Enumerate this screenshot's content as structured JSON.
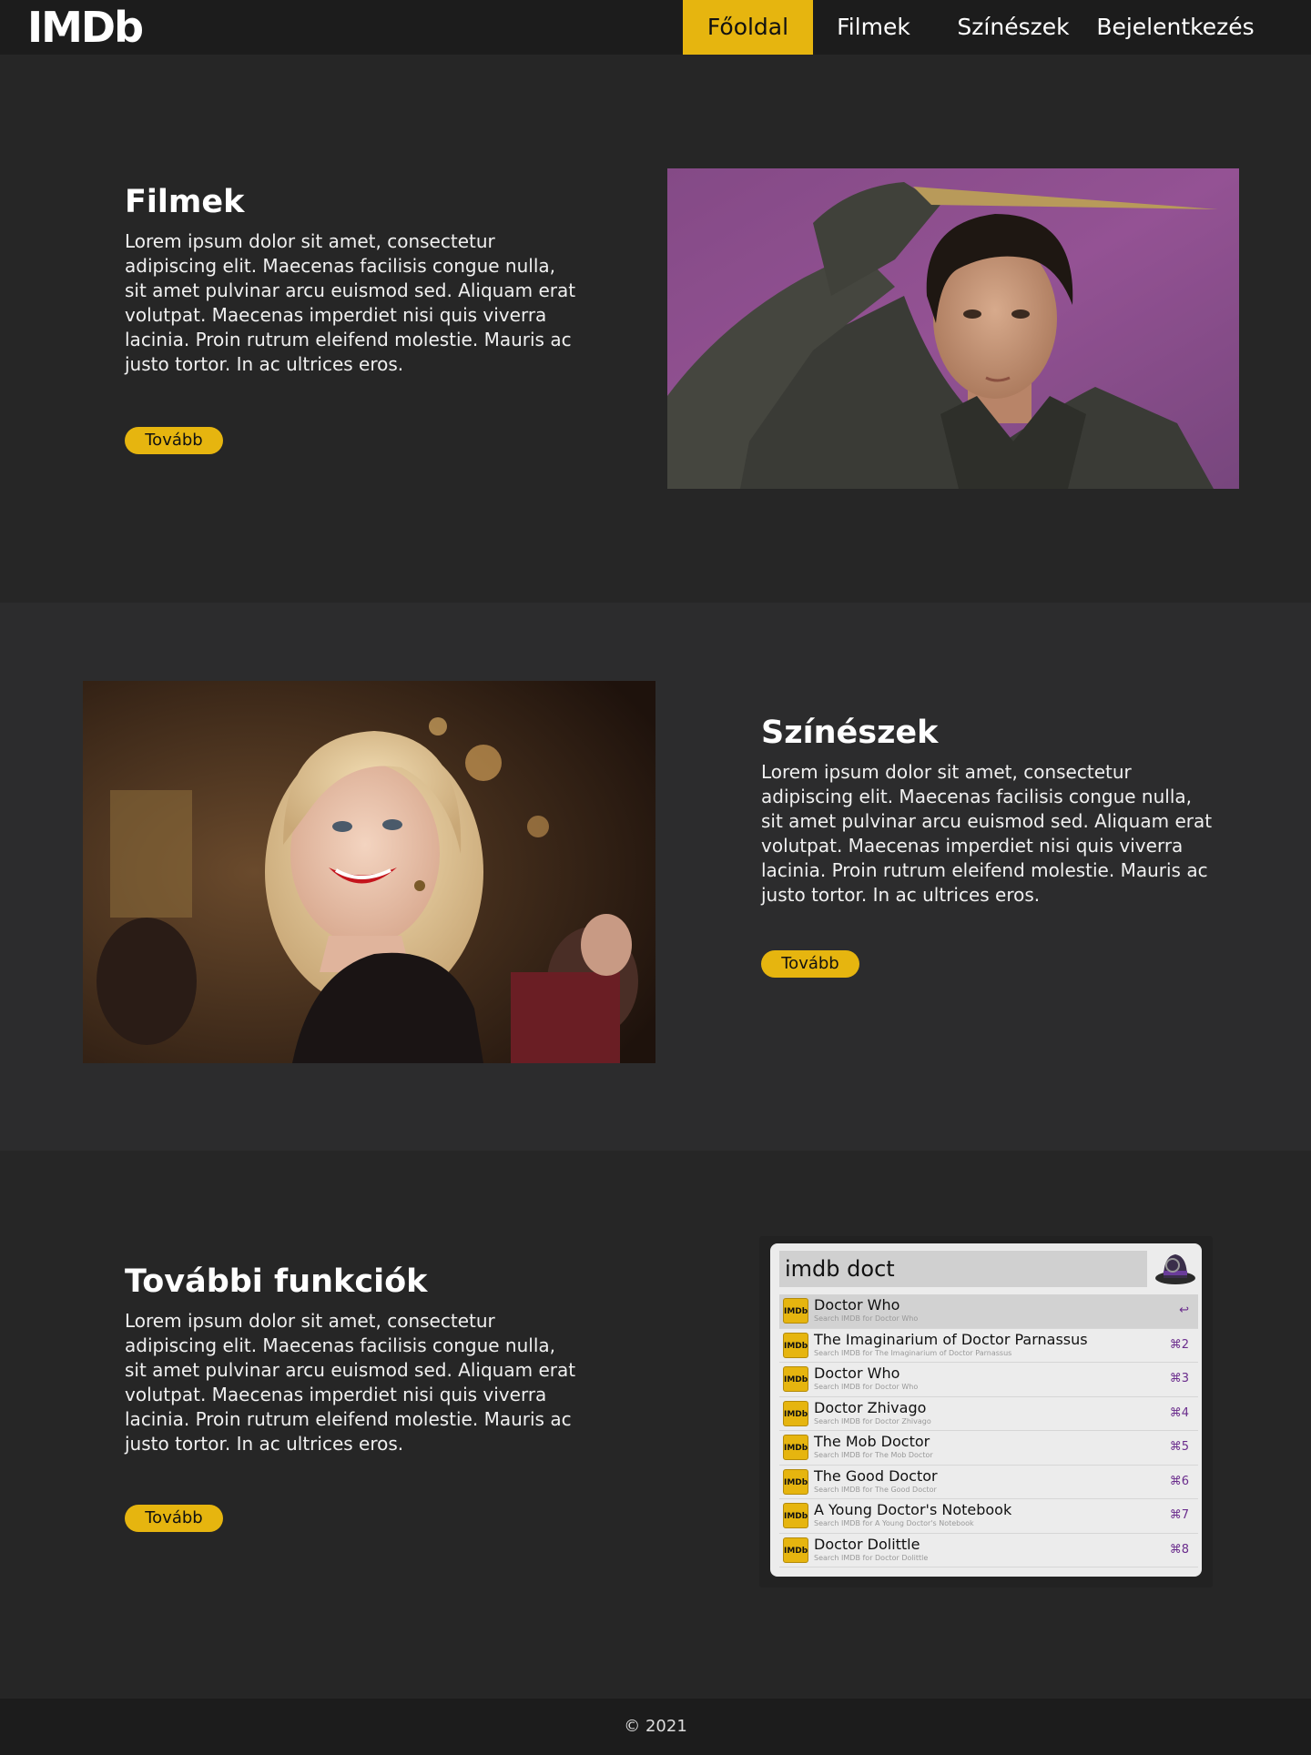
{
  "nav": {
    "logo": "IMDb",
    "items": [
      {
        "label": "Főoldal",
        "active": true
      },
      {
        "label": "Filmek"
      },
      {
        "label": "Színészek"
      },
      {
        "label": "Bejelentkezés"
      }
    ]
  },
  "sections": [
    {
      "title": "Filmek",
      "text": "Lorem ipsum dolor sit amet, consectetur adipiscing elit. Maecenas facilisis congue nulla, sit amet pulvinar arcu euismod sed. Aliquam erat volutpat. Maecenas imperdiet nisi quis viverra lacinia. Proin rutrum eleifend molestie. Mauris ac justo tortor. In ac ultrices eros.",
      "button": "Tovább"
    },
    {
      "title": "Színészek",
      "text": "Lorem ipsum dolor sit amet, consectetur adipiscing elit. Maecenas facilisis congue nulla, sit amet pulvinar arcu euismod sed. Aliquam erat volutpat. Maecenas imperdiet nisi quis viverra lacinia. Proin rutrum eleifend molestie. Mauris ac justo tortor. In ac ultrices eros.",
      "button": "Tovább"
    },
    {
      "title": "További funkciók",
      "text": "Lorem ipsum dolor sit amet, consectetur adipiscing elit. Maecenas facilisis congue nulla, sit amet pulvinar arcu euismod sed. Aliquam erat volutpat. Maecenas imperdiet nisi quis viverra lacinia. Proin rutrum eleifend molestie. Mauris ac justo tortor. In ac ultrices eros.",
      "button": "Tovább"
    }
  ],
  "alfred": {
    "query": "imdb doct",
    "icon_label": "IMDb",
    "results": [
      {
        "title": "Doctor Who",
        "sub": "Search IMDB for Doctor Who",
        "shortcut": "↩"
      },
      {
        "title": "The Imaginarium of Doctor Parnassus",
        "sub": "Search IMDB for The Imaginarium of Doctor Parnassus",
        "shortcut": "⌘2"
      },
      {
        "title": "Doctor Who",
        "sub": "Search IMDB for Doctor Who",
        "shortcut": "⌘3"
      },
      {
        "title": "Doctor Zhivago",
        "sub": "Search IMDB for Doctor Zhivago",
        "shortcut": "⌘4"
      },
      {
        "title": "The Mob Doctor",
        "sub": "Search IMDB for The Mob Doctor",
        "shortcut": "⌘5"
      },
      {
        "title": "The Good Doctor",
        "sub": "Search IMDB for The Good Doctor",
        "shortcut": "⌘6"
      },
      {
        "title": "A Young Doctor's Notebook",
        "sub": "Search IMDB for A Young Doctor's Notebook",
        "shortcut": "⌘7"
      },
      {
        "title": "Doctor Dolittle",
        "sub": "Search IMDB for Doctor Dolittle",
        "shortcut": "⌘8"
      }
    ]
  },
  "footer": {
    "text": "© 2021"
  },
  "colors": {
    "accent": "#e6b50f",
    "nav_bg": "#1c1c1c",
    "page_bg": "#262626",
    "alt_bg": "#2c2c2d"
  }
}
